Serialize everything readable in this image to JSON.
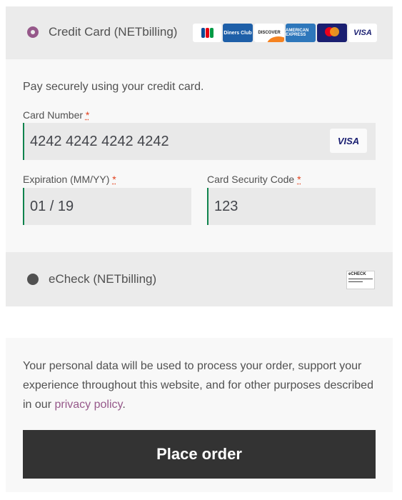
{
  "payment_methods": {
    "credit_card": {
      "label": "Credit Card (NETbilling)",
      "selected": true,
      "card_logos": [
        {
          "icon": "jcb-logo"
        },
        {
          "icon": "diners-club-logo",
          "text": "Diners Club"
        },
        {
          "icon": "discover-logo",
          "text": "DISCOVER"
        },
        {
          "icon": "american-express-logo",
          "text": "AMERICAN EXPRESS"
        },
        {
          "icon": "mastercard-logo",
          "text": "mastercard"
        },
        {
          "icon": "visa-logo",
          "text": "VISA"
        }
      ]
    },
    "echeck": {
      "label": "eCheck (NETbilling)",
      "selected": false,
      "logo_text": "eCHECK"
    }
  },
  "cc_form": {
    "description": "Pay securely using your credit card.",
    "card_number": {
      "label": "Card Number",
      "required_mark": "*",
      "value": "4242 4242 4242 4242",
      "detected_brand": "VISA"
    },
    "expiration": {
      "label": "Expiration (MM/YY)",
      "required_mark": "*",
      "value": "01 / 19"
    },
    "security_code": {
      "label": "Card Security Code",
      "required_mark": "*",
      "value": "123"
    }
  },
  "privacy": {
    "text_before": "Your personal data will be used to process your order, support your experience throughout this website, and for other purposes described in our ",
    "link_text": "privacy policy",
    "text_after": "."
  },
  "place_order_label": "Place order",
  "colors": {
    "accent": "#96588a",
    "field_border": "#0f834d",
    "required": "#e2401c",
    "button_bg": "#333333"
  }
}
